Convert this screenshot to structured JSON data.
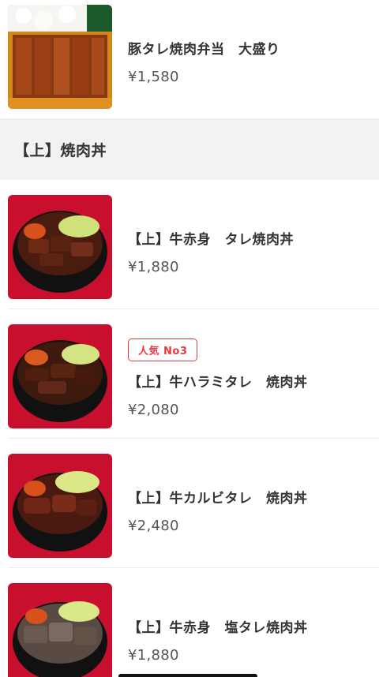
{
  "top_item": {
    "name": "豚タレ焼肉弁当　大盛り",
    "price": "¥1,580",
    "image_icon": "pork-bento-photo"
  },
  "section": {
    "title": "【上】焼肉丼"
  },
  "items": [
    {
      "name": "【上】牛赤身　タレ焼肉丼",
      "price": "¥1,880",
      "badge": "",
      "image_icon": "beef-bowl-photo"
    },
    {
      "name": "【上】牛ハラミタレ　焼肉丼",
      "price": "¥2,080",
      "badge": "人気 No3",
      "image_icon": "harami-bowl-photo"
    },
    {
      "name": "【上】牛カルビタレ　焼肉丼",
      "price": "¥2,480",
      "badge": "",
      "image_icon": "kalbi-bowl-photo"
    },
    {
      "name": "【上】牛赤身　塩タレ焼肉丼",
      "price": "¥1,880",
      "badge": "",
      "image_icon": "salt-beef-bowl-photo"
    }
  ],
  "colors": {
    "badge_red": "#e8383d",
    "section_bg": "#f2f2f2",
    "photo_bg_red": "#c8102e"
  }
}
